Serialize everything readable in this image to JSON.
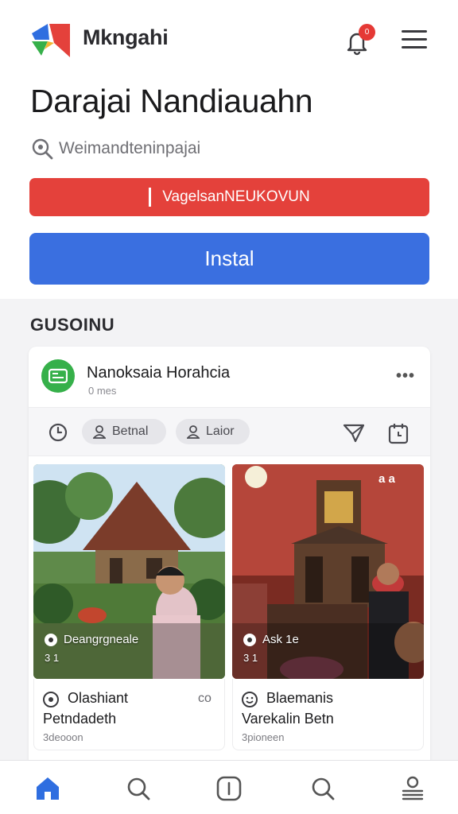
{
  "app": {
    "name": "Mkngahi"
  },
  "header": {
    "notification_count": "0"
  },
  "page": {
    "title": "Darajai Nandiauahn",
    "subtitle": "Weimandteninpajai"
  },
  "buttons": {
    "red_label": "VagelsanNEUKOVUN",
    "install_label": "Instal"
  },
  "section": {
    "title": "GUSOINU"
  },
  "card": {
    "title": "Nanoksaia Horahcia",
    "meta": "0 mes",
    "actions": [
      {
        "label": "Betnal",
        "icon": "user-icon"
      },
      {
        "label": "Laior",
        "icon": "user-icon"
      }
    ],
    "items": [
      {
        "overlay_label": "Deangrgneale",
        "overlay_sub": "3 1",
        "title": "Olashiant",
        "subtitle": "Petndadeth",
        "meta": "3deooon",
        "extra": "co"
      },
      {
        "overlay_label": "Ask 1e",
        "overlay_sub": "3 1",
        "badge": "a a",
        "title": "Blaemanis",
        "subtitle": "Varekalin Betn",
        "meta": "3pioneen",
        "extra": ""
      }
    ]
  },
  "bottom_nav": [
    {
      "icon": "home-icon",
      "active": true
    },
    {
      "icon": "search-icon",
      "active": false
    },
    {
      "icon": "info-icon",
      "active": false
    },
    {
      "icon": "search-icon",
      "active": false
    },
    {
      "icon": "profile-icon",
      "active": false
    }
  ],
  "colors": {
    "red_button": "#e4413b",
    "blue_button": "#3a6fe0",
    "active_nav": "#2f6ee0",
    "avatar": "#36b04a"
  }
}
